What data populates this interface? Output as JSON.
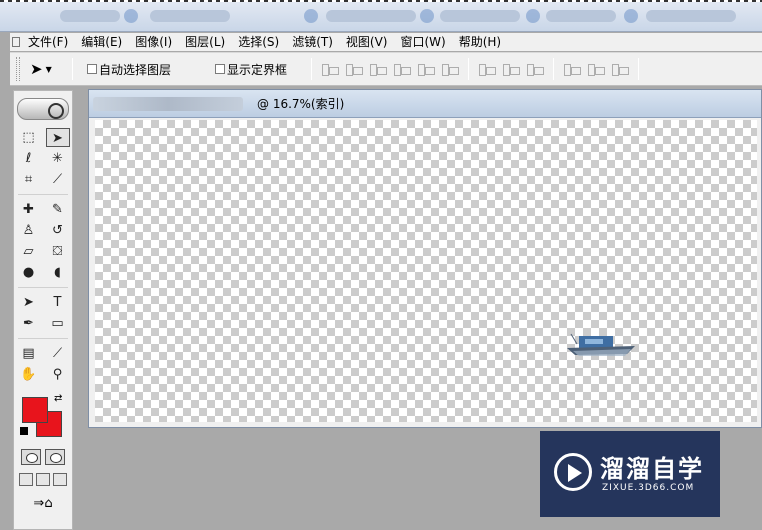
{
  "menu": {
    "items": [
      {
        "label": "文件(F)"
      },
      {
        "label": "编辑(E)"
      },
      {
        "label": "图像(I)"
      },
      {
        "label": "图层(L)"
      },
      {
        "label": "选择(S)"
      },
      {
        "label": "滤镜(T)"
      },
      {
        "label": "视图(V)"
      },
      {
        "label": "窗口(W)"
      },
      {
        "label": "帮助(H)"
      }
    ]
  },
  "options": {
    "auto_select_label": "自动选择图层",
    "show_bounds_label": "显示定界框"
  },
  "tools": {
    "foreground_color": "#e8141c",
    "background_color": "#e8141c"
  },
  "document": {
    "title": "@ 16.7%(索引)"
  },
  "watermark": {
    "title": "溜溜自学",
    "subtitle": "ZIXUE.3D66.COM"
  }
}
